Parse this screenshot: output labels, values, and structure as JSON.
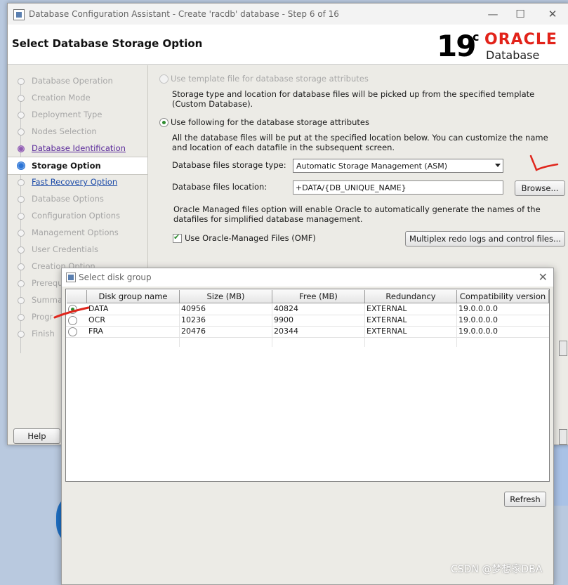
{
  "window": {
    "title": "Database Configuration Assistant - Create 'racdb' database - Step 6 of 16",
    "minimize": "—",
    "maximize": "☐",
    "close": "✕"
  },
  "header": {
    "title": "Select Database Storage Option",
    "logo_version": "19",
    "logo_c": "c",
    "logo_brand": "ORACLE",
    "logo_product": "Database"
  },
  "sidebar": {
    "steps": [
      {
        "label": "Database Operation"
      },
      {
        "label": "Creation Mode"
      },
      {
        "label": "Deployment Type"
      },
      {
        "label": "Nodes Selection"
      },
      {
        "label": "Database Identification"
      },
      {
        "label": "Storage Option"
      },
      {
        "label": "Fast Recovery Option"
      },
      {
        "label": "Database Options"
      },
      {
        "label": "Configuration Options"
      },
      {
        "label": "Management Options"
      },
      {
        "label": "User Credentials"
      },
      {
        "label": "Creation Option"
      },
      {
        "label": "Prerequ"
      },
      {
        "label": "Summa"
      },
      {
        "label": "Progr"
      },
      {
        "label": "Finish"
      }
    ]
  },
  "main": {
    "template_option": "Use template file for database storage attributes",
    "template_desc_1": "Storage type and location for database files will be picked up from the specified template",
    "template_desc_2": "(Custom Database).",
    "following_option": "Use following for the database storage attributes",
    "following_desc_1": "All the database files will be put at the specified location below. You can customize the name",
    "following_desc_2": "and location of each datafile in the subsequent screen.",
    "storage_type_label": "Database files storage type:",
    "storage_type_value": "Automatic Storage Management (ASM)",
    "location_label": "Database files location:",
    "location_value": "+DATA/{DB_UNIQUE_NAME}",
    "browse_label": "Browse...",
    "omf_desc_1": "Oracle Managed files option will enable Oracle to automatically generate the names of the",
    "omf_desc_2": "datafiles for simplified database management.",
    "omf_checkbox_label": "Use Oracle-Managed Files (OMF)",
    "multiplex_label": "Multiplex redo logs and control files..."
  },
  "footer": {
    "help_label": "Help"
  },
  "dialog": {
    "title": "Select disk group",
    "close": "✕",
    "columns": [
      "Disk group name",
      "Size (MB)",
      "Free (MB)",
      "Redundancy",
      "Compatibility version"
    ],
    "rows": [
      {
        "name": "DATA",
        "size": "40956",
        "free": "40824",
        "redundancy": "EXTERNAL",
        "compat": "19.0.0.0.0",
        "selected": true
      },
      {
        "name": "OCR",
        "size": "10236",
        "free": "9900",
        "redundancy": "EXTERNAL",
        "compat": "19.0.0.0.0",
        "selected": false
      },
      {
        "name": "FRA",
        "size": "20476",
        "free": "20344",
        "redundancy": "EXTERNAL",
        "compat": "19.0.0.0.0",
        "selected": false
      }
    ],
    "refresh_label": "Refresh"
  },
  "watermark": "CSDN @梦想家DBA",
  "colors": {
    "oracle_red": "#e2231a",
    "annotation_red": "#e0261c",
    "selected_radio": "#2e8b2e",
    "current_step": "#2b74d6"
  }
}
